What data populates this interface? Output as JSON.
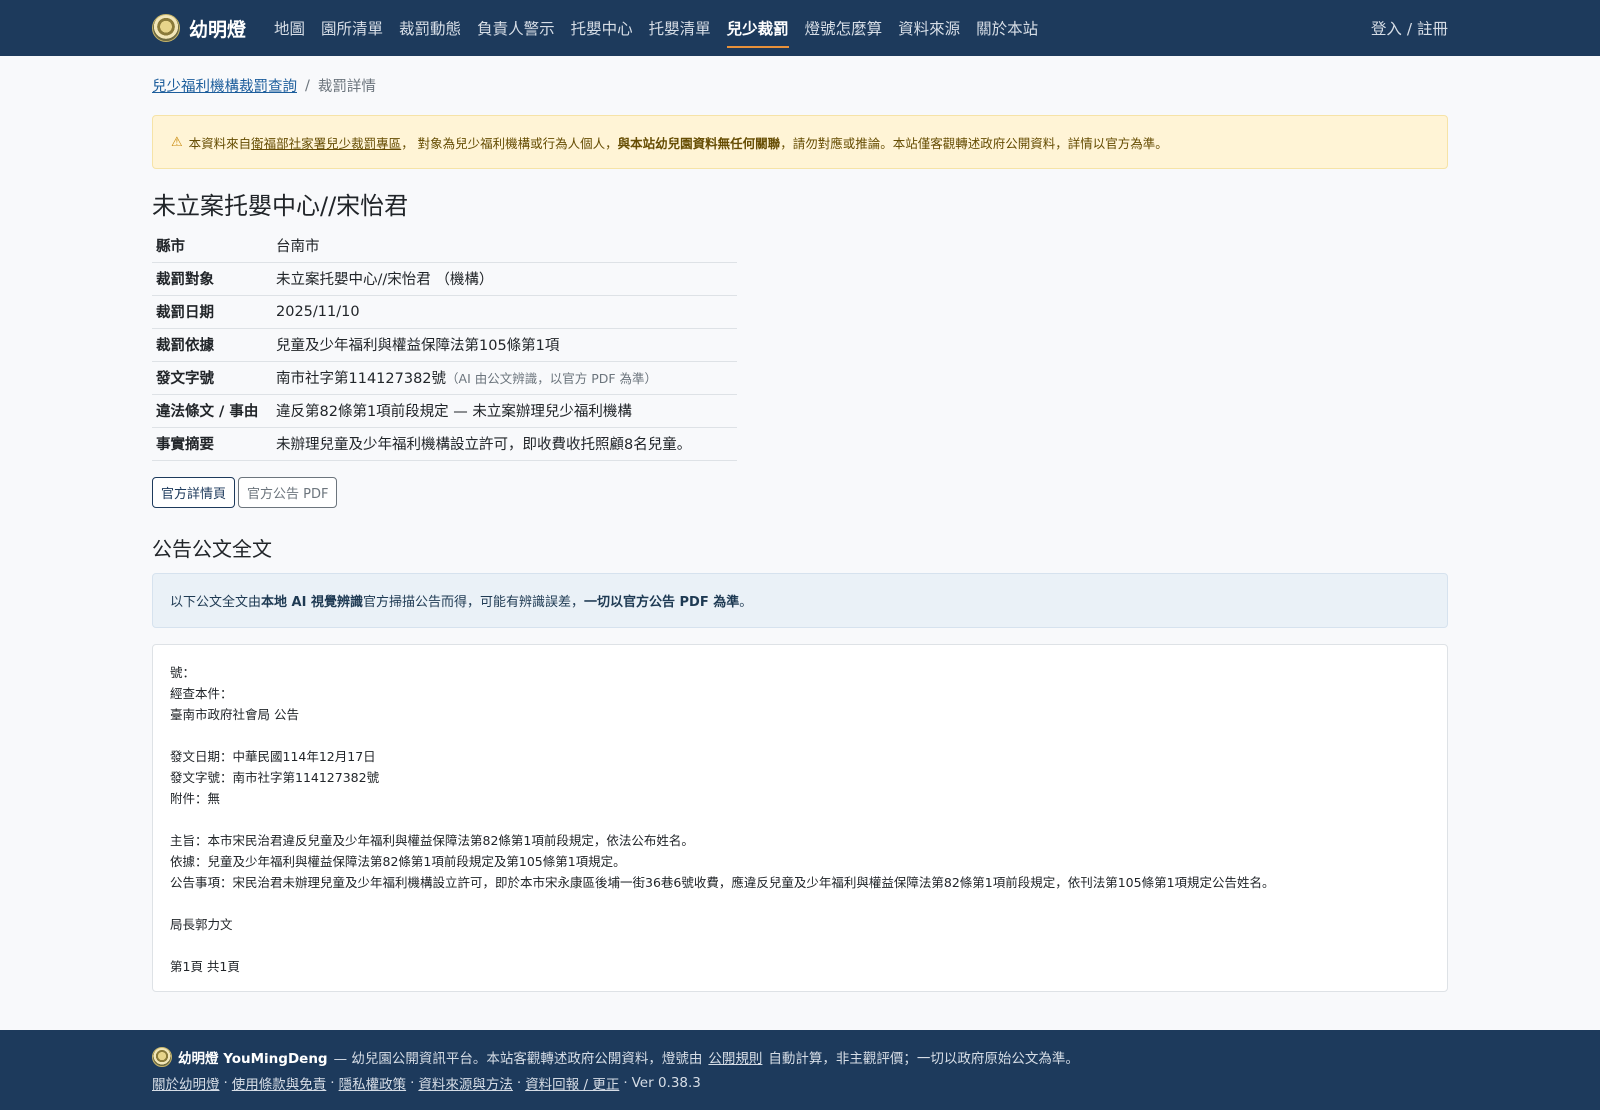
{
  "nav": {
    "brand": "幼明燈",
    "links": [
      "地圖",
      "園所清單",
      "裁罰動態",
      "負責人警示",
      "托嬰中心",
      "托嬰清單",
      "兒少裁罰",
      "燈號怎麼算",
      "資料來源",
      "關於本站"
    ],
    "active_index": 6,
    "login": "登入 / 註冊"
  },
  "breadcrumb": {
    "parent": "兒少福利機構裁罰查詢",
    "separator": "/",
    "current": "裁罰詳情"
  },
  "warning": {
    "prefix": "本資料來自",
    "source_link": "衛福部社家署兒少裁罰專區",
    "middle": "， 對象為兒少福利機構或行為人個人，",
    "bold": "與本站幼兒園資料無任何關聯",
    "suffix": "，請勿對應或推論。本站僅客觀轉述政府公開資料，詳情以官方為準。"
  },
  "title": "未立案托嬰中心//宋怡君",
  "info": {
    "county_label": "縣市",
    "county": "台南市",
    "target_label": "裁罰對象",
    "target": "未立案托嬰中心//宋怡君 （機構）",
    "date_label": "裁罰日期",
    "date": "2025/11/10",
    "basis_label": "裁罰依據",
    "basis": "兒童及少年福利與權益保障法第105條第1項",
    "doc_no_label": "發文字號",
    "doc_no": "南市社字第114127382號",
    "doc_no_note": "（AI 由公文辨識，以官方 PDF 為準）",
    "violation_label": "違法條文 / 事由",
    "violation": "違反第82條第1項前段規定 — 未立案辦理兒少福利機構",
    "summary_label": "事實摘要",
    "summary": "未辦理兒童及少年福利機構設立許可，即收費收托照顧8名兒童。"
  },
  "buttons": {
    "official_page": "官方詳情頁",
    "official_pdf": "官方公告 PDF"
  },
  "fulltext": {
    "heading": "公告公文全文",
    "note_prefix": "以下公文全文由",
    "note_bold1": "本地 AI 視覺辨識",
    "note_middle": "官方掃描公告而得，可能有辨識誤差，",
    "note_bold2": "一切以官方公告 PDF 為準",
    "note_suffix": "。",
    "lines": [
      "號：",
      "經查本件：",
      "臺南市政府社會局 公告",
      "",
      "發文日期：中華民國114年12月17日",
      "發文字號：南市社字第114127382號",
      "附件：無",
      "",
      "主旨：本市宋民治君違反兒童及少年福利與權益保障法第82條第1項前段規定，依法公布姓名。",
      "依據：兒童及少年福利與權益保障法第82條第1項前段規定及第105條第1項規定。",
      "公告事項：宋民治君未辦理兒童及少年福利機構設立許可，即於本市宋永康區後埔一街36巷6號收費，應違反兒童及少年福利與權益保障法第82條第1項前段規定，依刊法第105條第1項規定公告姓名。",
      "",
      "局長郭力文",
      "",
      "第1頁 共1頁"
    ]
  },
  "footer": {
    "brand": "幼明燈 YouMingDeng",
    "tagline_prefix": "— 幼兒園公開資訊平台。本站客觀轉述政府公開資料，燈號由",
    "tagline_link": "公開規則",
    "tagline_suffix": "自動計算，非主觀評價；一切以政府原始公文為準。",
    "links": [
      "關於幼明燈",
      "使用條款與免責",
      "隱私權政策",
      "資料來源與方法",
      "資料回報 / 更正"
    ],
    "link_separator": "·",
    "version": "Ver 0.38.3"
  }
}
